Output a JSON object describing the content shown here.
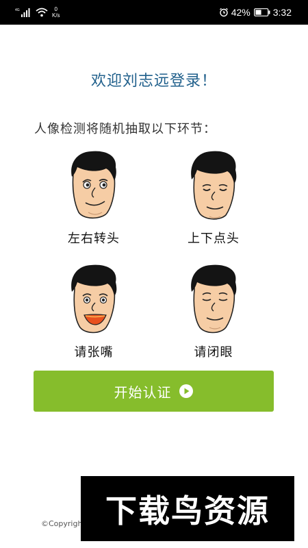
{
  "status_bar": {
    "network": "4G",
    "speed_value": "0",
    "speed_unit": "K/s",
    "battery_percent": "42%",
    "time": "3:32",
    "icons": [
      "signal-icon",
      "wifi-icon",
      "alarm-icon",
      "battery-icon"
    ]
  },
  "welcome_title": "欢迎刘志远登录！",
  "intro_text": "人像检测将随机抽取以下环节：",
  "steps": [
    {
      "label": "左右转头",
      "icon": "face-turn-head-icon"
    },
    {
      "label": "上下点头",
      "icon": "face-nod-head-icon"
    },
    {
      "label": "请张嘴",
      "icon": "face-open-mouth-icon"
    },
    {
      "label": "请闭眼",
      "icon": "face-close-eyes-icon"
    }
  ],
  "start_button": {
    "label": "开始认证",
    "icon": "play-circle-icon"
  },
  "copyright": "©Copyrigh",
  "watermark": "下载鸟资源",
  "colors": {
    "accent_green": "#86bd2c",
    "title_blue": "#1f5f8b",
    "skin": "#f6cda5",
    "hair": "#141414"
  }
}
